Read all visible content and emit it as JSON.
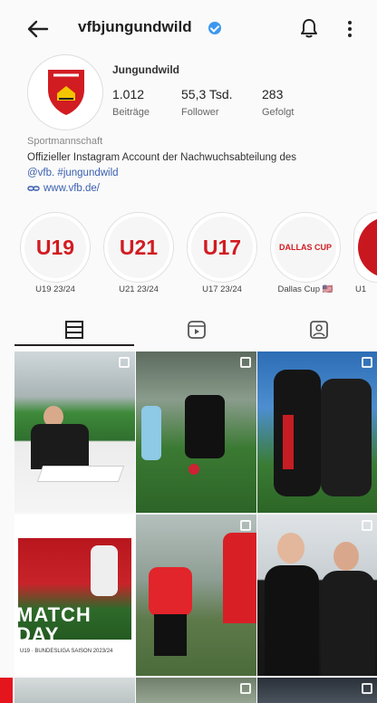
{
  "header": {
    "username": "vfbjungundwild"
  },
  "profile": {
    "display_name": "Jungundwild",
    "stats": [
      {
        "value": "1.012",
        "label": "Beiträge"
      },
      {
        "value": "55,3 Tsd.",
        "label": "Follower"
      },
      {
        "value": "283",
        "label": "Gefolgt"
      }
    ],
    "category": "Sportmannschaft",
    "bio_line1": "Offizieller Instagram Account der Nachwuchsabteilung des",
    "bio_mention": "@vfb.",
    "bio_hashtag": "#jungundwild",
    "link": "www.vfb.de/"
  },
  "highlights": [
    {
      "cover_text": "U19",
      "label": "U19 23/24"
    },
    {
      "cover_text": "U21",
      "label": "U21 23/24"
    },
    {
      "cover_text": "U17",
      "label": "U17 23/24"
    },
    {
      "cover_text": "DALLAS CUP",
      "label": "Dallas Cup 🇺🇸"
    },
    {
      "cover_text": "",
      "label": "U1"
    }
  ],
  "posts": {
    "matchday_text": "MATCH DAY",
    "matchday_small": "U19 · BUNDESLIGA\nSAISON 2023/24"
  },
  "colors": {
    "accent": "#d11c22",
    "link": "#3b5fb0",
    "verified": "#3b97f0"
  }
}
